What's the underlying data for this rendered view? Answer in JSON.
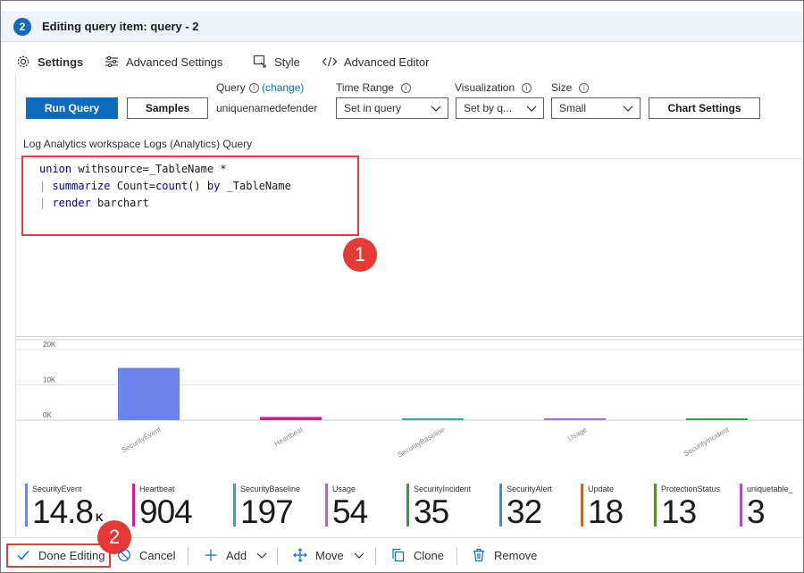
{
  "header": {
    "step_number": "2",
    "title": "Editing query item: query - 2"
  },
  "tabs": [
    {
      "label": "Settings",
      "icon": "gear-icon",
      "active": true
    },
    {
      "label": "Advanced Settings",
      "icon": "sliders-icon",
      "active": false
    },
    {
      "label": "Style",
      "icon": "style-icon",
      "active": false
    },
    {
      "label": "Advanced Editor",
      "icon": "code-icon",
      "active": false
    }
  ],
  "toolbar": {
    "run_query_label": "Run Query",
    "samples_label": "Samples",
    "query_label": "Query",
    "query_change_link": "(change)",
    "query_value": "uniquenamedefender",
    "time_range_label": "Time Range",
    "time_range_value": "Set in query",
    "visualization_label": "Visualization",
    "visualization_value": "Set by q...",
    "size_label": "Size",
    "size_value": "Small",
    "chart_settings_label": "Chart Settings"
  },
  "workspace_label": "Log Analytics workspace Logs (Analytics) Query",
  "editor": {
    "lines": [
      {
        "pipe": "",
        "kw": "union",
        "rest": " withsource=_TableName *"
      },
      {
        "pipe": "| ",
        "kw": "summarize",
        "rest": " Count=",
        "fn": "count",
        "rest2": "() ",
        "kw2": "by",
        "rest3": " _TableName"
      },
      {
        "pipe": "| ",
        "kw": "render",
        "rest": " barchart"
      }
    ]
  },
  "callouts": {
    "first": "1",
    "second": "2"
  },
  "chart_data": {
    "type": "bar",
    "categories": [
      "SecurityEvent",
      "Heartbeat",
      "SecurityBaseline",
      "Usage",
      "SecurityIncident"
    ],
    "values": [
      14800,
      904,
      197,
      54,
      35
    ],
    "bar_colors": [
      "#6d83ec",
      "#d81b8c",
      "#3aa6a0",
      "#9c6fd0",
      "#2f9e44"
    ],
    "y_ticks": [
      "20K",
      "10K",
      "0K"
    ],
    "ylim": [
      0,
      20000
    ],
    "grid": true,
    "title": "",
    "xlabel": "",
    "ylabel": ""
  },
  "tiles": [
    {
      "name": "SecurityEvent",
      "value": "14.8",
      "unit": "K",
      "color": "#6d83ec"
    },
    {
      "name": "Heartbeat",
      "value": "904",
      "unit": "",
      "color": "#d81b8c"
    },
    {
      "name": "SecurityBaseline",
      "value": "197",
      "unit": "",
      "color": "#3aa6a0"
    },
    {
      "name": "Usage",
      "value": "54",
      "unit": "",
      "color": "#9c6fd0"
    },
    {
      "name": "SecurityIncident",
      "value": "35",
      "unit": "",
      "color": "#2f9e44"
    },
    {
      "name": "SecurityAlert",
      "value": "32",
      "unit": "",
      "color": "#3b8fd4"
    },
    {
      "name": "Update",
      "value": "18",
      "unit": "",
      "color": "#c8671d"
    },
    {
      "name": "ProtectionStatus",
      "value": "13",
      "unit": "",
      "color": "#5b8a2c"
    },
    {
      "name": "uniquetable_",
      "value": "3",
      "unit": "",
      "color": "#b24fc4"
    }
  ],
  "bottom_bar": {
    "done_label": "Done Editing",
    "cancel_label": "Cancel",
    "add_label": "Add",
    "move_label": "Move",
    "clone_label": "Clone",
    "remove_label": "Remove"
  },
  "colors": {
    "accent": "#0f6cbd",
    "highlight": "#e03c3c",
    "callout": "#e53935"
  }
}
